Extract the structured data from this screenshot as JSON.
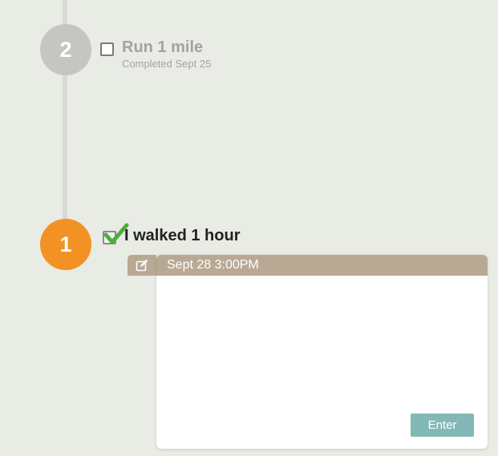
{
  "timeline": {
    "steps": [
      {
        "number": "2",
        "title": "Run 1 mile",
        "subtitle": "Completed Sept 25",
        "checked": false,
        "circle_color": "#c5c6c1"
      },
      {
        "number": "1",
        "title": "I walked 1 hour",
        "checked": true,
        "circle_color": "#f39224"
      }
    ]
  },
  "note_card": {
    "header_text": "Sept 28 3:00PM",
    "header_color": "#b9a994",
    "enter_label": "Enter",
    "enter_color": "#82b9b6",
    "edit_icon": "edit-icon"
  },
  "colors": {
    "background": "#e9ebe5",
    "check_green": "#4caf3c"
  }
}
